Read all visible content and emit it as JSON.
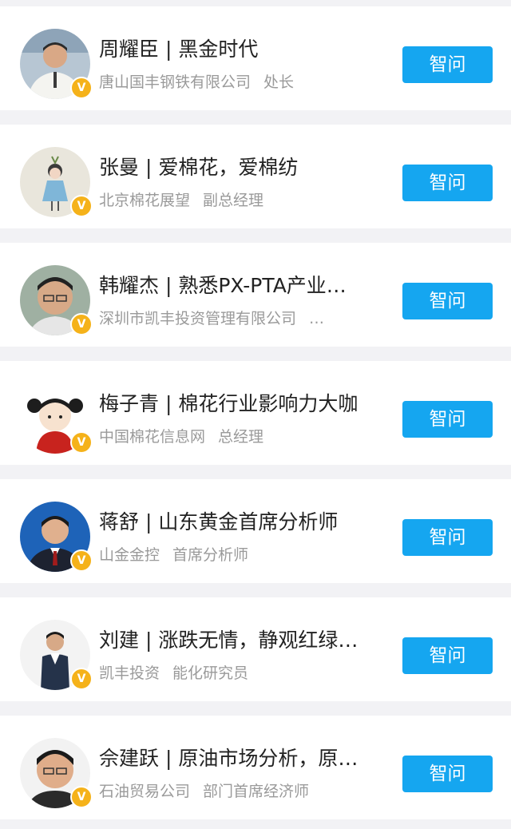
{
  "experts": [
    {
      "title": "周耀臣 | 黑金时代",
      "company": "唐山国丰钢铁有限公司",
      "position": "处长",
      "button": "智问",
      "badge": "V"
    },
    {
      "title": "张曼 | 爱棉花，爱棉纺",
      "company": "北京棉花展望",
      "position": "副总经理",
      "button": "智问",
      "badge": "V"
    },
    {
      "title": "韩耀杰 | 熟悉PX-PTA产业…",
      "company": "深圳市凯丰投资管理有限公司",
      "position": "…",
      "button": "智问",
      "badge": "V"
    },
    {
      "title": "梅子青 | 棉花行业影响力大咖",
      "company": "中国棉花信息网",
      "position": "总经理",
      "button": "智问",
      "badge": "V"
    },
    {
      "title": "蒋舒 | 山东黄金首席分析师",
      "company": "山金金控",
      "position": "首席分析师",
      "button": "智问",
      "badge": "V"
    },
    {
      "title": "刘建 | 涨跌无情，静观红绿…",
      "company": "凯丰投资",
      "position": "能化研究员",
      "button": "智问",
      "badge": "V"
    },
    {
      "title": "佘建跃 | 原油市场分析，原…",
      "company": "石油贸易公司",
      "position": "部门首席经济师",
      "button": "智问",
      "badge": "V"
    }
  ],
  "colors": {
    "accent": "#15a6f0",
    "badge": "#f5b21a",
    "background": "#f2f2f5",
    "subtitle": "#9a9a9a"
  }
}
